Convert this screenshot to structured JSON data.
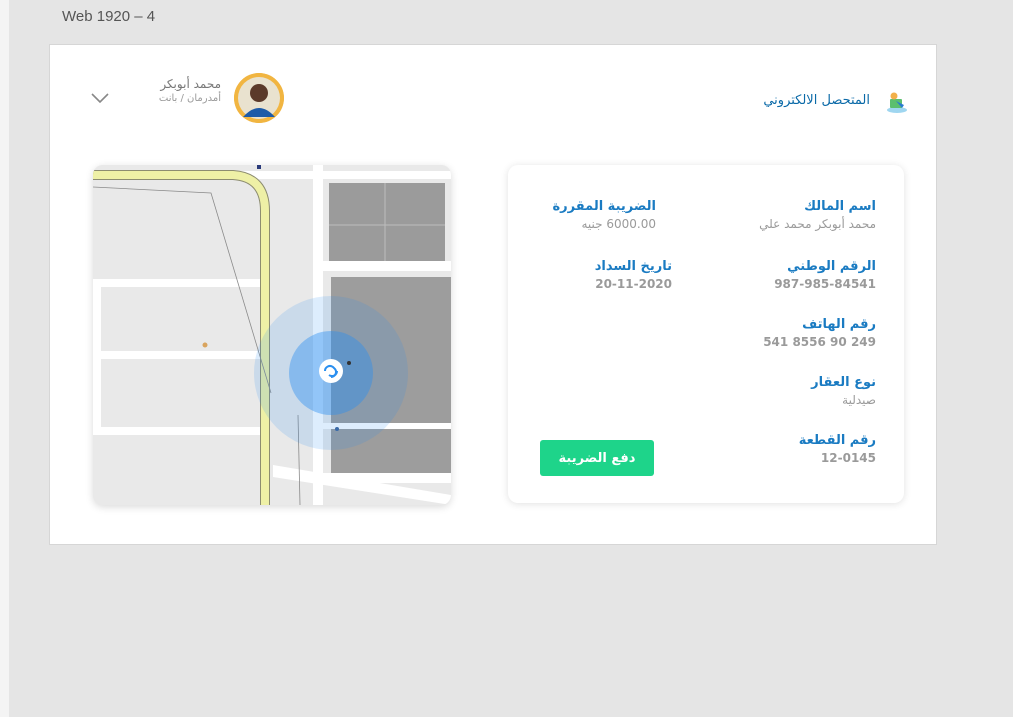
{
  "canvas": {
    "label": "Web 1920 – 4"
  },
  "header": {
    "brand_title": "المتحصل الالكتروني",
    "brand_icon": "e-collector-icon",
    "user": {
      "name": "محمد أبوبكر",
      "role": "أمدرمان / بانت",
      "avatar_icon": "user-avatar",
      "menu_icon": "chevron-down-icon"
    }
  },
  "map": {
    "marker_icon": "location-link-icon",
    "accent": "#2a8ff0"
  },
  "property": {
    "owner_label": "اسم المالك",
    "owner_value": "محمد أبوبكر محمد علي",
    "national_id_label": "الرقم الوطني",
    "national_id_value": "987-985-84541",
    "phone_label": "رقم الهاتف",
    "phone_value": "249 90 8556 541",
    "type_label": "نوع العقار",
    "type_value": "صيدلية",
    "plot_label": "رقم القطعة",
    "plot_value": "12-0145",
    "tax_label": "الضريبة المقررة",
    "tax_value": "6000.00 جنيه",
    "payment_date_label": "تاريخ السداد",
    "payment_date_value": "20-11-2020",
    "pay_button": "دفع الضريبة"
  },
  "colors": {
    "accent": "#1a7bc2",
    "pay": "#1ed48a",
    "background": "#e5e5e5"
  }
}
